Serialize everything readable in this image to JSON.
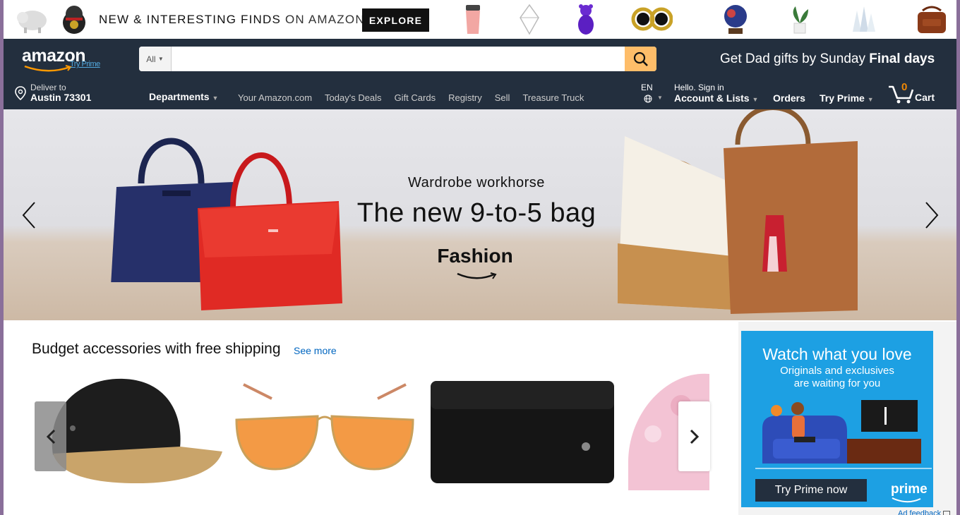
{
  "promo": {
    "title_bold": "NEW & INTERESTING FINDS",
    "title_rest": " ON AMAZON",
    "explore_label": "EXPLORE"
  },
  "header": {
    "logo_text": "amazon",
    "try_prime_link": "Try Prime",
    "search": {
      "scope": "All",
      "placeholder": ""
    },
    "promo_text_1": "Get Dad gifts by Sunday ",
    "promo_text_2": "Final days",
    "deliver_line1": "Deliver to",
    "deliver_line2": "Austin 73301",
    "departments": "Departments",
    "links": [
      "Your Amazon.com",
      "Today's Deals",
      "Gift Cards",
      "Registry",
      "Sell",
      "Treasure Truck"
    ],
    "lang": "EN",
    "account_line1": "Hello. Sign in",
    "account_line2": "Account & Lists",
    "orders": "Orders",
    "try_prime": "Try Prime",
    "cart_count": "0",
    "cart_label": "Cart"
  },
  "hero": {
    "subtitle": "Wardrobe workhorse",
    "headline": "The new 9-to-5 bag",
    "brand": "Fashion"
  },
  "budget": {
    "title": "Budget accessories with free shipping",
    "see_more": "See more"
  },
  "ad": {
    "headline": "Watch what you love",
    "subtext": "Originals and exclusives are waiting for you",
    "cta": "Try Prime now",
    "brand": "prime",
    "feedback": "Ad feedback"
  },
  "colors": {
    "nav_bg": "#232f3e",
    "search_button": "#febd69",
    "link": "#0066c0",
    "ad_bg": "#1da0e3",
    "cart_count": "#f08804"
  }
}
